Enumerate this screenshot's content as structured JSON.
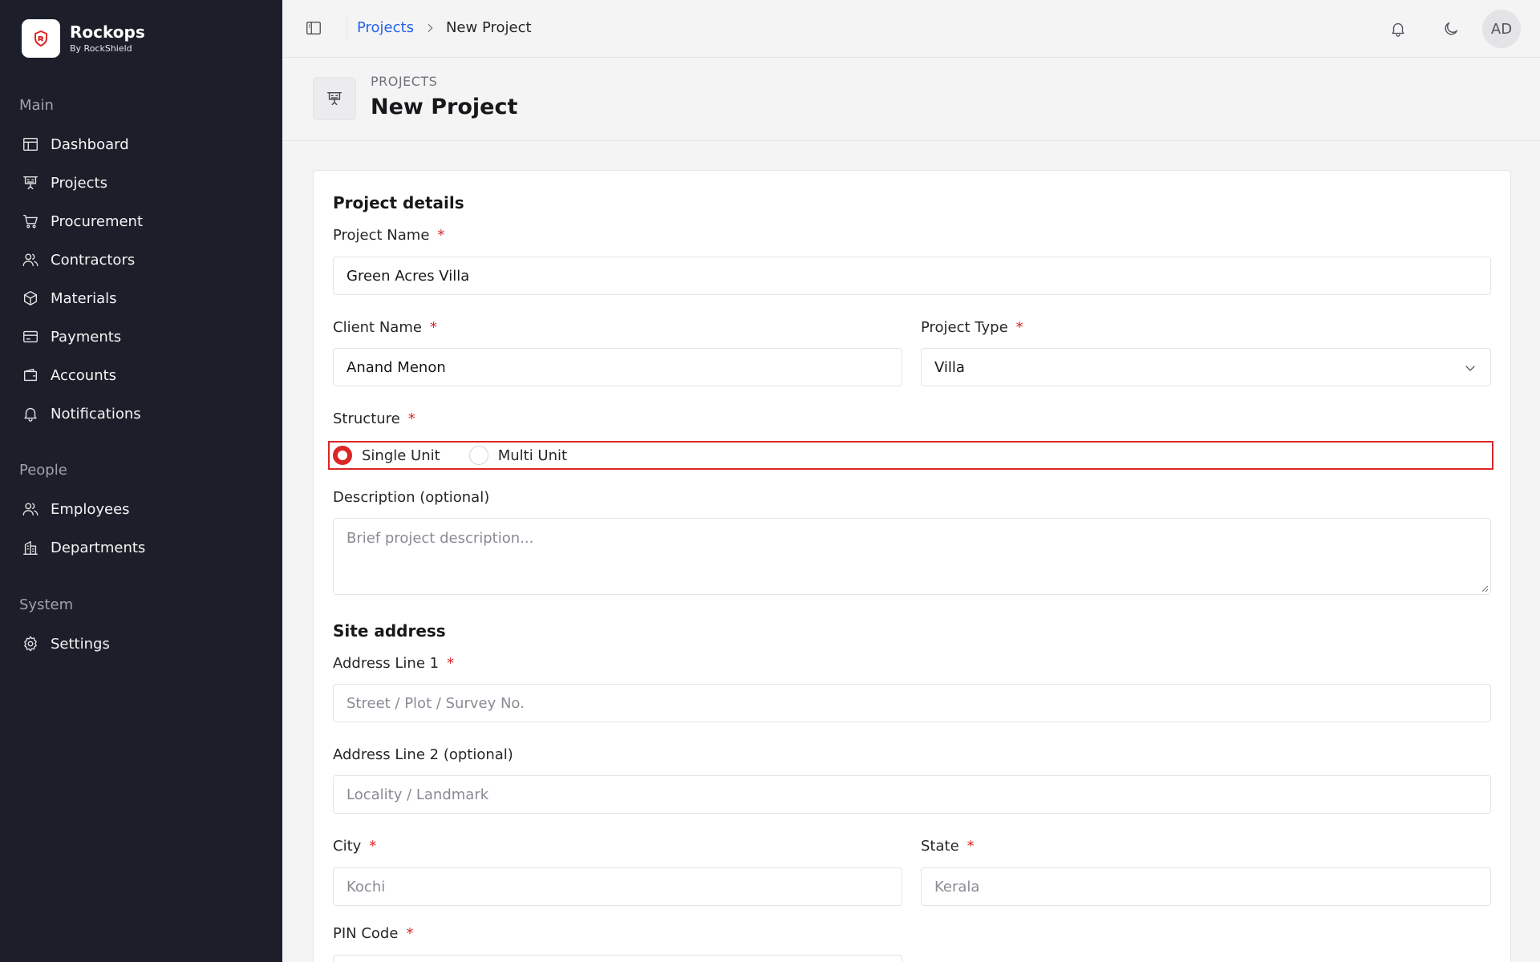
{
  "brand": {
    "name": "Rockops",
    "sub": "By RockShield"
  },
  "sidebar": {
    "sections": [
      {
        "title": "Main"
      },
      {
        "title": "People"
      },
      {
        "title": "System"
      }
    ],
    "items": [
      {
        "label": "Dashboard",
        "icon": "dashboard-icon"
      },
      {
        "label": "Projects",
        "icon": "projects-icon"
      },
      {
        "label": "Procurement",
        "icon": "cart-icon"
      },
      {
        "label": "Contractors",
        "icon": "users-icon"
      },
      {
        "label": "Materials",
        "icon": "box-icon"
      },
      {
        "label": "Payments",
        "icon": "card-icon"
      },
      {
        "label": "Accounts",
        "icon": "wallet-icon"
      },
      {
        "label": "Notifications",
        "icon": "bell-icon"
      },
      {
        "label": "Employees",
        "icon": "users-icon"
      },
      {
        "label": "Departments",
        "icon": "building-icon"
      },
      {
        "label": "Settings",
        "icon": "gear-icon"
      }
    ]
  },
  "topbar": {
    "breadcrumb": {
      "parent": "Projects",
      "current": "New Project"
    },
    "avatar_initials": "AD"
  },
  "page": {
    "eyebrow": "PROJECTS",
    "title": "New Project"
  },
  "form": {
    "project_details_title": "Project details",
    "project_name": {
      "label": "Project Name",
      "value": "Green Acres Villa"
    },
    "client_name": {
      "label": "Client Name",
      "value": "Anand Menon"
    },
    "project_type": {
      "label": "Project Type",
      "value": "Villa"
    },
    "structure": {
      "label": "Structure",
      "options": [
        "Single Unit",
        "Multi Unit"
      ],
      "selected": "Single Unit"
    },
    "description": {
      "label": "Description (optional)",
      "placeholder": "Brief project description..."
    },
    "site_address_title": "Site address",
    "address1": {
      "label": "Address Line 1",
      "placeholder": "Street / Plot / Survey No."
    },
    "address2": {
      "label": "Address Line 2 (optional)",
      "placeholder": "Locality / Landmark"
    },
    "city": {
      "label": "City",
      "placeholder": "Kochi"
    },
    "state": {
      "label": "State",
      "placeholder": "Kerala"
    },
    "pin": {
      "label": "PIN Code"
    },
    "required_marker": "*"
  },
  "colors": {
    "accent": "#dc2626",
    "link": "#2563eb",
    "sidebar_bg": "#1c1f29"
  }
}
